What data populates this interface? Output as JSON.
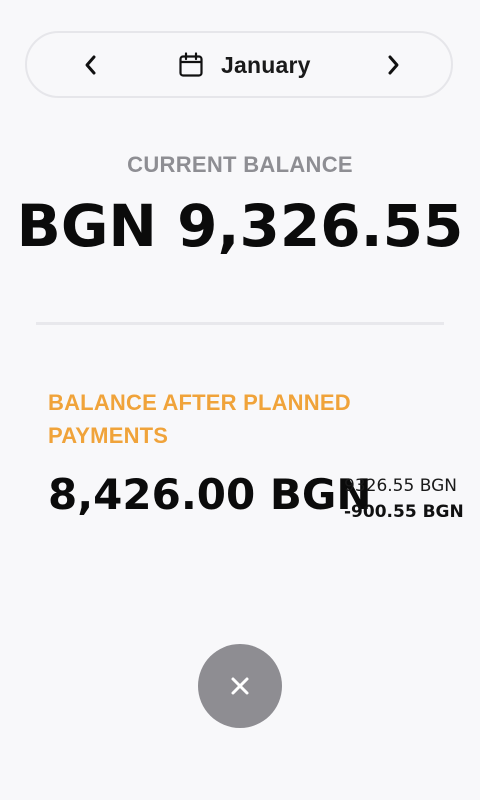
{
  "header": {
    "month": "January",
    "prev_icon": "chevron-left-icon",
    "next_icon": "chevron-right-icon",
    "calendar_icon": "calendar-icon"
  },
  "current_balance": {
    "label": "CURRENT BALANCE",
    "value": "BGN 9,326.55"
  },
  "planned": {
    "label": "BALANCE AFTER PLANNED PAYMENTS",
    "value": "8,426.00 BGN",
    "breakdown_balance": "9326.55 BGN",
    "breakdown_payments": "-900.55 BGN"
  },
  "fab": {
    "icon": "close-icon"
  },
  "colors": {
    "background": "#f8f8fa",
    "accent_orange": "#f0a33a",
    "muted_gray": "#8e8e93",
    "fab_gray": "#8e8d92"
  }
}
